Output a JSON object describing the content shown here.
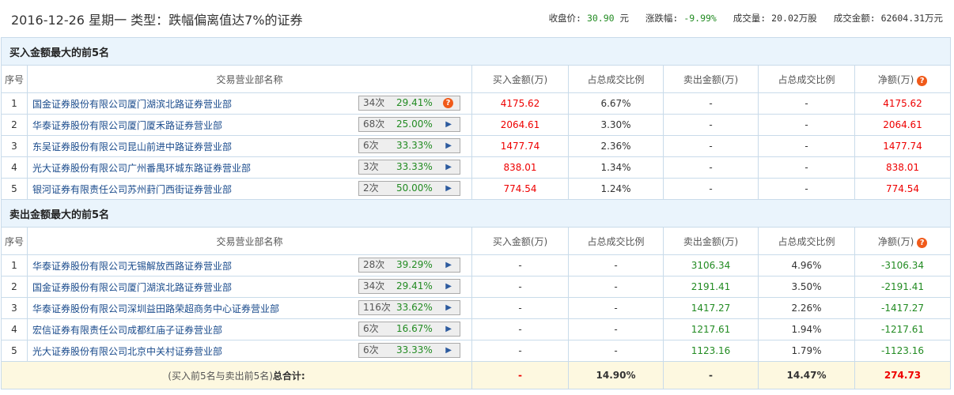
{
  "header": {
    "title": "2016-12-26 星期一  类型：跌幅偏离值达7%的证券",
    "close_label": "收盘价:",
    "close": "30.90",
    "close_unit": "元",
    "chg_label": "涨跌幅:",
    "chg": "-9.99%",
    "vol_label": "成交量:",
    "vol": "20.02万股",
    "amt_label": "成交金额:",
    "amt": "62604.31万元"
  },
  "columns": [
    "序号",
    "交易营业部名称",
    "买入金额(万)",
    "占总成交比例",
    "卖出金额(万)",
    "占总成交比例",
    "净额(万)"
  ],
  "buy": {
    "title": "买入金额最大的前5名",
    "rows": [
      {
        "n": "1",
        "name": "国金证券股份有限公司厦门湖滨北路证券营业部",
        "times": "34次",
        "pct": "29.41%",
        "buy": "4175.62",
        "buy_ratio": "6.67%",
        "sell": "-",
        "sell_ratio": "-",
        "net": "4175.62",
        "q": true
      },
      {
        "n": "2",
        "name": "华泰证券股份有限公司厦门厦禾路证券营业部",
        "times": "68次",
        "pct": "25.00%",
        "buy": "2064.61",
        "buy_ratio": "3.30%",
        "sell": "-",
        "sell_ratio": "-",
        "net": "2064.61"
      },
      {
        "n": "3",
        "name": "东吴证券股份有限公司昆山前进中路证券营业部",
        "times": "6次",
        "pct": "33.33%",
        "buy": "1477.74",
        "buy_ratio": "2.36%",
        "sell": "-",
        "sell_ratio": "-",
        "net": "1477.74"
      },
      {
        "n": "4",
        "name": "光大证券股份有限公司广州番禺环城东路证券营业部",
        "times": "3次",
        "pct": "33.33%",
        "buy": "838.01",
        "buy_ratio": "1.34%",
        "sell": "-",
        "sell_ratio": "-",
        "net": "838.01"
      },
      {
        "n": "5",
        "name": "银河证券有限责任公司苏州葑门西街证券营业部",
        "times": "2次",
        "pct": "50.00%",
        "buy": "774.54",
        "buy_ratio": "1.24%",
        "sell": "-",
        "sell_ratio": "-",
        "net": "774.54"
      }
    ]
  },
  "sell": {
    "title": "卖出金额最大的前5名",
    "rows": [
      {
        "n": "1",
        "name": "华泰证券股份有限公司无锡解放西路证券营业部",
        "times": "28次",
        "pct": "39.29%",
        "buy": "-",
        "buy_ratio": "-",
        "sell": "3106.34",
        "sell_ratio": "4.96%",
        "net": "-3106.34"
      },
      {
        "n": "2",
        "name": "国金证券股份有限公司厦门湖滨北路证券营业部",
        "times": "34次",
        "pct": "29.41%",
        "buy": "-",
        "buy_ratio": "-",
        "sell": "2191.41",
        "sell_ratio": "3.50%",
        "net": "-2191.41"
      },
      {
        "n": "3",
        "name": "华泰证券股份有限公司深圳益田路荣超商务中心证券营业部",
        "times": "116次",
        "pct": "33.62%",
        "buy": "-",
        "buy_ratio": "-",
        "sell": "1417.27",
        "sell_ratio": "2.26%",
        "net": "-1417.27"
      },
      {
        "n": "4",
        "name": "宏信证券有限责任公司成都红庙子证券营业部",
        "times": "6次",
        "pct": "16.67%",
        "buy": "-",
        "buy_ratio": "-",
        "sell": "1217.61",
        "sell_ratio": "1.94%",
        "net": "-1217.61"
      },
      {
        "n": "5",
        "name": "光大证券股份有限公司北京中关村证券营业部",
        "times": "6次",
        "pct": "33.33%",
        "buy": "-",
        "buy_ratio": "-",
        "sell": "1123.16",
        "sell_ratio": "1.79%",
        "net": "-1123.16"
      }
    ]
  },
  "total": {
    "label_prefix": "(买入前5名与卖出前5名)",
    "label_bold": "总合计:",
    "buy": "-",
    "buy_ratio": "14.90%",
    "sell": "-",
    "sell_ratio": "14.47%",
    "net": "274.73"
  },
  "icons": {
    "help": "?",
    "arrow": "▶"
  }
}
